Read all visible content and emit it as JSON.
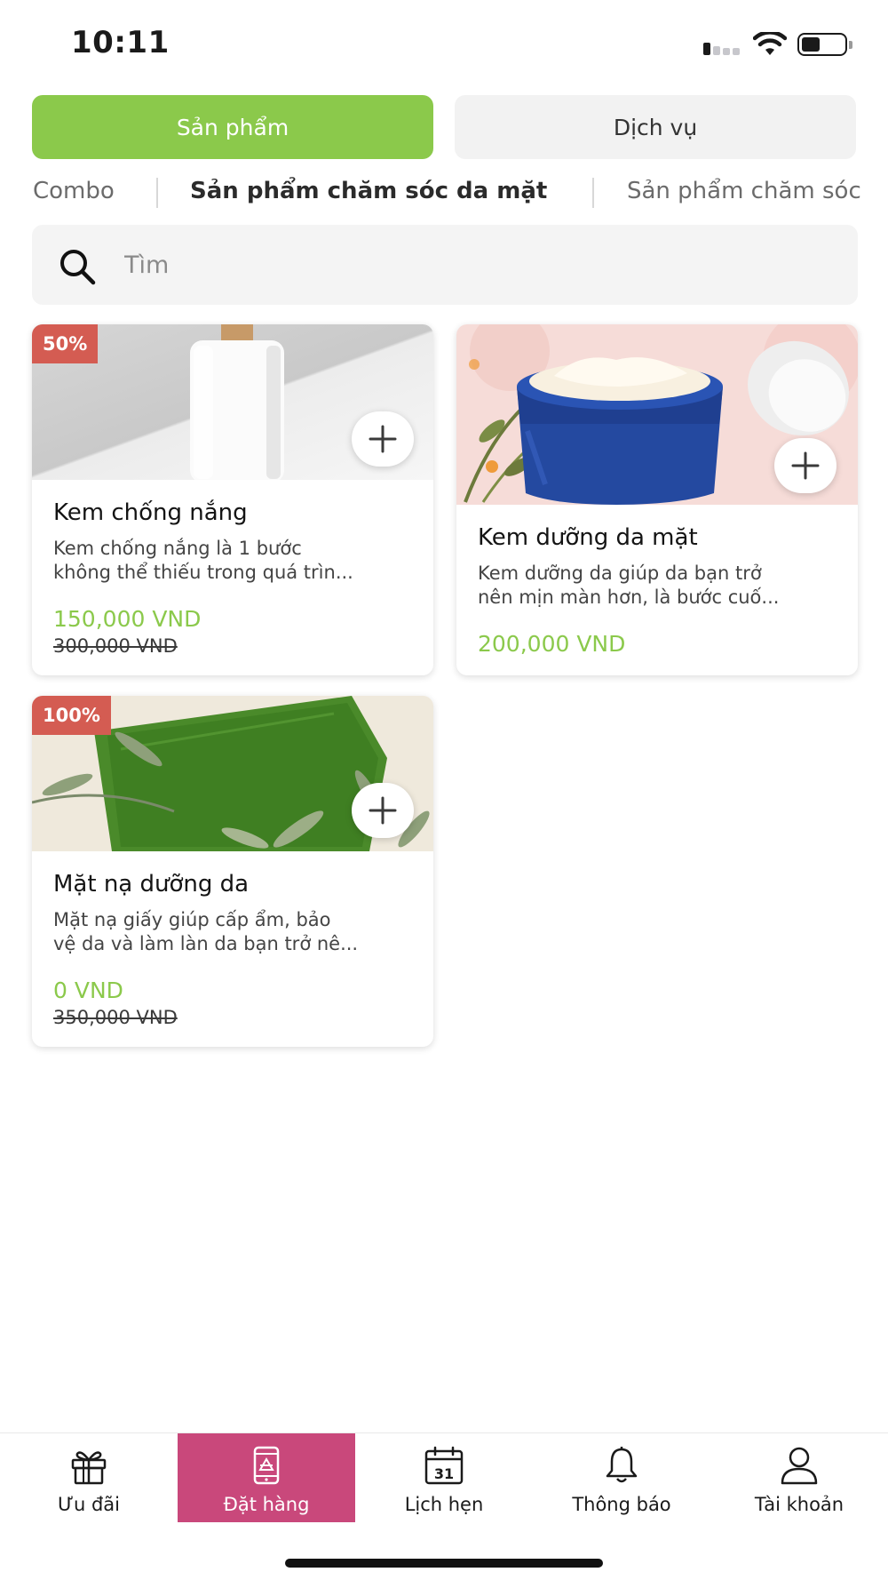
{
  "status_bar": {
    "time": "10:11",
    "icons": [
      "signal-icon",
      "wifi-icon",
      "battery-icon"
    ]
  },
  "main_tabs": [
    {
      "label": "Sản phẩm",
      "active": true
    },
    {
      "label": "Dịch vụ",
      "active": false
    }
  ],
  "categories": [
    {
      "label": "Combo",
      "active": false
    },
    {
      "label": "Sản phẩm chăm sóc da mặt",
      "active": true
    },
    {
      "label": "Sản phẩm chăm sóc",
      "active": false
    }
  ],
  "search": {
    "placeholder": "Tìm",
    "value": ""
  },
  "products": [
    {
      "discount_badge": "50%",
      "title": "Kem chống nắng",
      "description_line1": "Kem chống nắng là 1 bước",
      "description_line2": "không thể thiếu trong quá trìn...",
      "price": "150,000 VND",
      "old_price": "300,000 VND"
    },
    {
      "discount_badge": "",
      "title": "Kem dưỡng da mặt",
      "description_line1": "Kem dưỡng da giúp da bạn trở",
      "description_line2": "nên mịn màn hơn, là bước cuố...",
      "price": "200,000 VND",
      "old_price": ""
    },
    {
      "discount_badge": "100%",
      "title": "Mặt nạ dưỡng da",
      "description_line1": "Mặt nạ giấy giúp cấp ẩm, bảo",
      "description_line2": "vệ da và làm làn da bạn trở nê...",
      "price": "0 VND",
      "old_price": "350,000 VND"
    }
  ],
  "bottom_nav": [
    {
      "label": "Ưu đãi",
      "icon": "gift-icon",
      "active": false
    },
    {
      "label": "Đặt hàng",
      "icon": "order-phone-icon",
      "active": true
    },
    {
      "label": "Lịch hẹn",
      "icon": "calendar-icon",
      "active": false,
      "icon_text": "31"
    },
    {
      "label": "Thông báo",
      "icon": "bell-icon",
      "active": false
    },
    {
      "label": "Tài khoản",
      "icon": "user-icon",
      "active": false
    }
  ],
  "colors": {
    "accent_green": "#8bc94b",
    "nav_active": "#c9487b",
    "badge_red": "#d45c52"
  }
}
